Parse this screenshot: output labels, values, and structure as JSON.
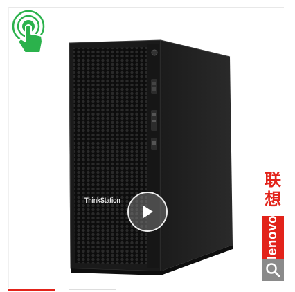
{
  "product": {
    "image_alt": "Lenovo ThinkStation tower workstation",
    "case_label": "ThinkStation"
  },
  "brand": {
    "cn_line1": "联",
    "cn_line2": "想",
    "en": "lenovo",
    "color": "#e2231a"
  },
  "icons": {
    "tap": "tap-touch-icon",
    "play": "play-icon",
    "zoom": "magnifier-icon"
  },
  "colors": {
    "tap_icon": "#2bb24c",
    "zoom_bg": "#8a8a8a",
    "active_thumb": "#e2231a"
  }
}
